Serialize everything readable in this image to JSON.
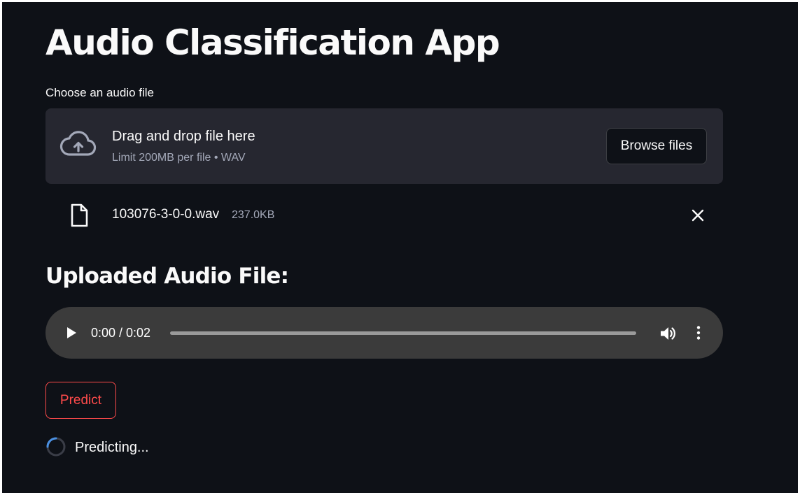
{
  "app": {
    "title": "Audio Classification App"
  },
  "uploader": {
    "label": "Choose an audio file",
    "drop_title": "Drag and drop file here",
    "limit_text": "Limit 200MB per file • WAV",
    "browse_label": "Browse files",
    "upload_icon": "cloud-upload-icon"
  },
  "uploaded_file": {
    "name": "103076-3-0-0.wav",
    "size": "237.0KB",
    "file_icon": "file-icon",
    "remove_icon": "close-icon"
  },
  "section": {
    "heading": "Uploaded Audio File:"
  },
  "audio_player": {
    "time": "0:00 / 0:02",
    "progress": 0,
    "play_icon": "play-icon",
    "volume_icon": "volume-icon",
    "menu_icon": "more-vertical-icon"
  },
  "predict": {
    "label": "Predict"
  },
  "status": {
    "spinner_text": "Predicting...",
    "spinner_icon": "spinner-icon"
  },
  "colors": {
    "background": "#0e1117",
    "panel": "#262730",
    "text": "#fafafa",
    "muted_text": "#a3a8b8",
    "accent": "#ff4b4b",
    "player_background": "#3b3b3b",
    "spinner_accent": "#4a90e2"
  }
}
